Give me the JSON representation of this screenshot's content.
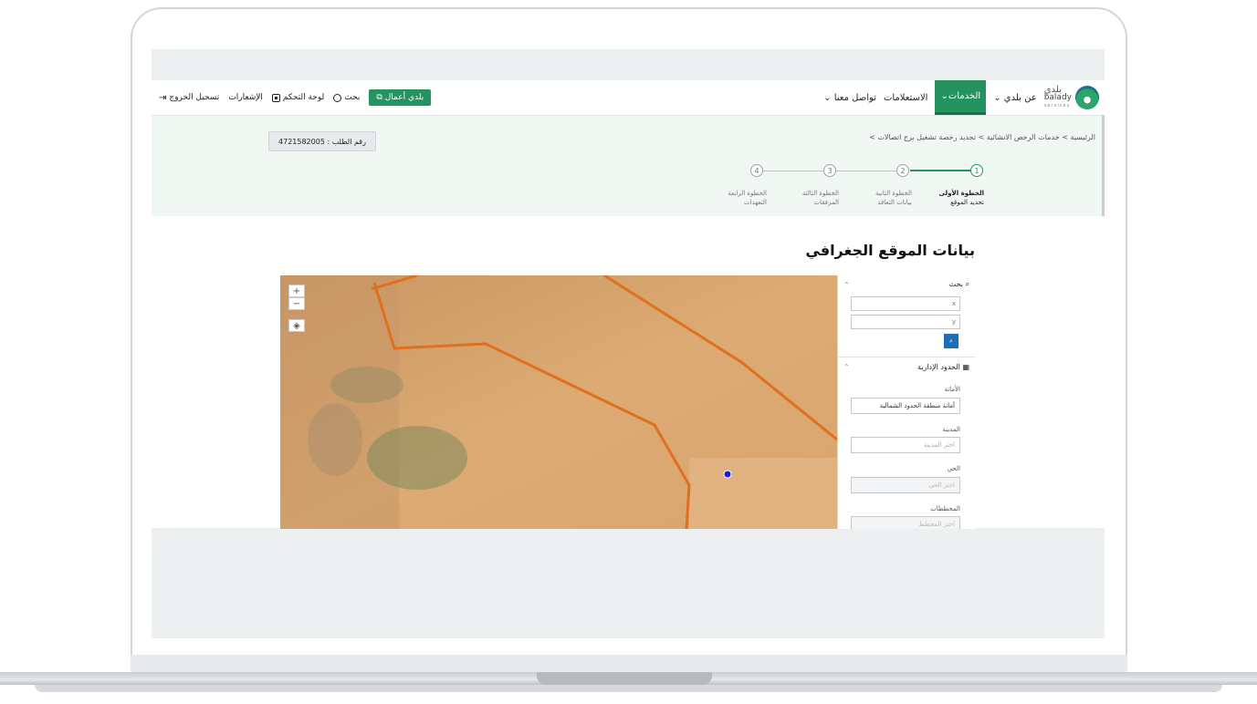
{
  "nav": {
    "logo_ar": "بلدي",
    "logo_en": "balady",
    "logo_sub": "services",
    "about": "عن بلدي",
    "services": "الخدمات",
    "inquiries": "الاستعلامات",
    "contact": "تواصل معنا",
    "balady_business": "بلدي أعمال",
    "search": "بحث",
    "dashboard": "لوحة التحكم",
    "notifications": "الإشعارات",
    "logout": "تسجيل الخروج",
    "brand_color": "#25935f"
  },
  "breadcrumb": {
    "home": "الرئيسية",
    "item2": "خدمات الرخص الانشائية",
    "item3": "تجديد رخصة تشغيل برج اتصالات",
    "sep": ">"
  },
  "order": {
    "label": "رقم الطلب : 4721582005"
  },
  "steps": [
    {
      "number": "1",
      "title": "الخطوة الأولى",
      "subtitle": "تحديد الموقع",
      "active": true
    },
    {
      "number": "2",
      "title": "الخطوة الثانية",
      "subtitle": "بيانات التعاقد",
      "active": false
    },
    {
      "number": "3",
      "title": "الخطوة الثالثة",
      "subtitle": "المرفقات",
      "active": false
    },
    {
      "number": "4",
      "title": "الخطوة الرابعة",
      "subtitle": "التعهدات",
      "active": false
    }
  ],
  "page": {
    "title": "بيانات الموقع الجغرافي"
  },
  "map": {
    "zoom_in": "+",
    "zoom_out": "−",
    "layers_icon": "layers-icon",
    "marker_color": "#1a1adc",
    "boundary_color": "#e0701e"
  },
  "panel": {
    "search_title": "بحث",
    "x_placeholder": "x",
    "y_placeholder": "y",
    "admin_title": "الحدود الإدارية",
    "amana_label": "الأمانة",
    "amana_value": "أمانة منطقة الحدود الشمالية",
    "city_label": "المدينة",
    "city_placeholder": "اختر المدينة",
    "district_label": "الحي",
    "district_placeholder": "اختر الحي",
    "plans_label": "المخططات",
    "plans_placeholder": "اختر المخطط"
  }
}
